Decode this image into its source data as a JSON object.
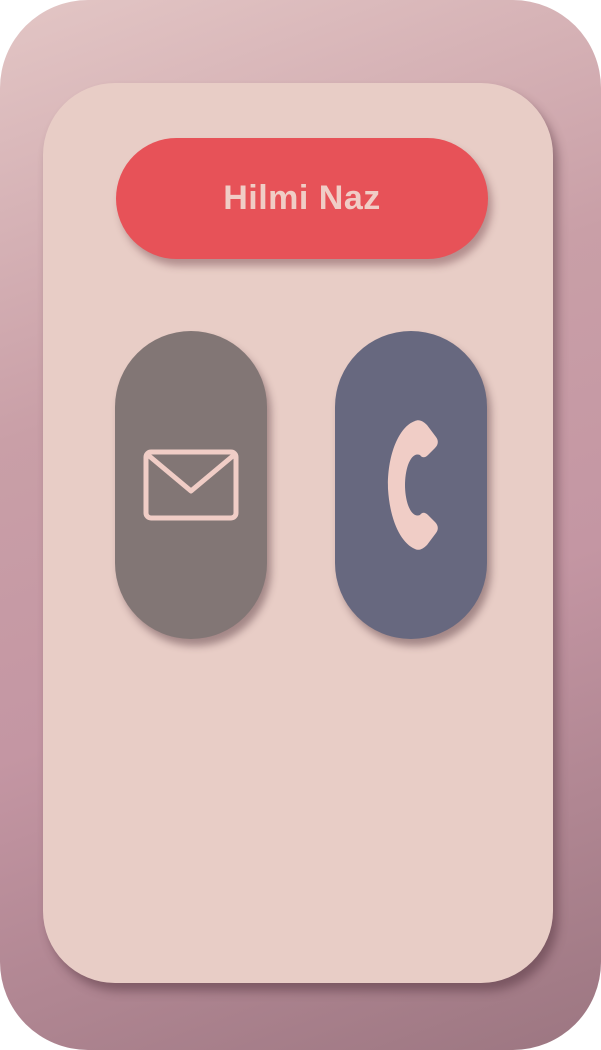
{
  "contact": {
    "name": "Hilmi Naz"
  },
  "actions": [
    {
      "id": "message",
      "icon": "mail-icon"
    },
    {
      "id": "call",
      "icon": "phone-icon"
    }
  ],
  "colors": {
    "background_light": "#e3c6c5",
    "background_dark": "#9c7681",
    "card": "#e8cdc6",
    "name_pill": "#e75258",
    "name_text": "#f0cdc6",
    "message_button": "#827675",
    "call_button": "#67687f",
    "icon_stroke": "#f0cdc6"
  }
}
